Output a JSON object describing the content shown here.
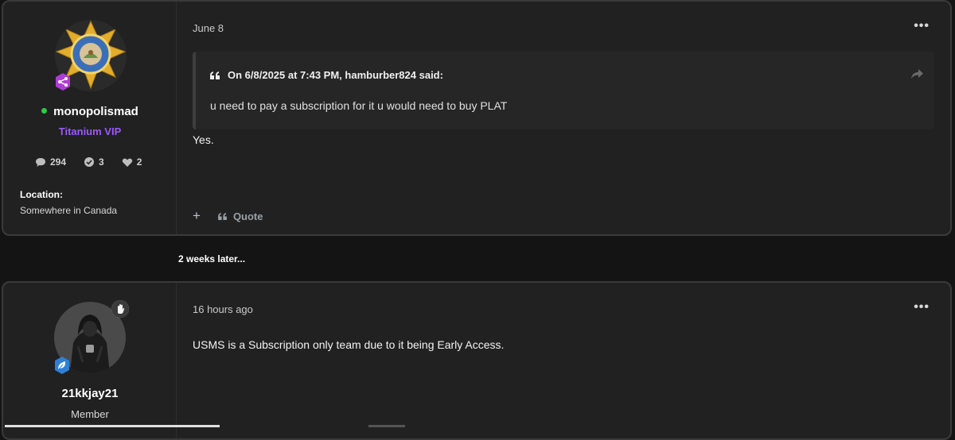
{
  "post1": {
    "author": {
      "username": "monopolismad",
      "title": "Titanium VIP",
      "online": true,
      "avatar": "california-highway-patrol-badge",
      "badge_icon": "share-nodes-icon",
      "stats": {
        "posts": "294",
        "solutions": "3",
        "reactions": "2"
      },
      "location_label": "Location:",
      "location_value": "Somewhere in Canada"
    },
    "date": "June 8",
    "menu_label": "•••",
    "quote": {
      "header": "On 6/8/2025 at 7:43 PM, hamburber824 said:",
      "text": "u need to pay a subscription for it u would need to buy PLAT"
    },
    "text": "Yes.",
    "actions": {
      "plus": "+",
      "quote_label": "Quote"
    }
  },
  "separator": "2 weeks later...",
  "post2": {
    "author": {
      "username": "21kkjay21",
      "title": "Member",
      "avatar": "person-in-hoodie-photo",
      "badge_icon": "leaf-icon",
      "corner_icon": "hand-icon"
    },
    "date": "16 hours ago",
    "menu_label": "•••",
    "text": "USMS is a Subscription only team due to it being Early Access."
  },
  "colors": {
    "page_bg": "#141414",
    "post_bg": "#212121",
    "vip": "#9b59ff",
    "online": "#2ecc40",
    "badge_purple": "#b03cd6",
    "badge_blue": "#2f7fd6",
    "star_gold": "#e3ad2c"
  }
}
